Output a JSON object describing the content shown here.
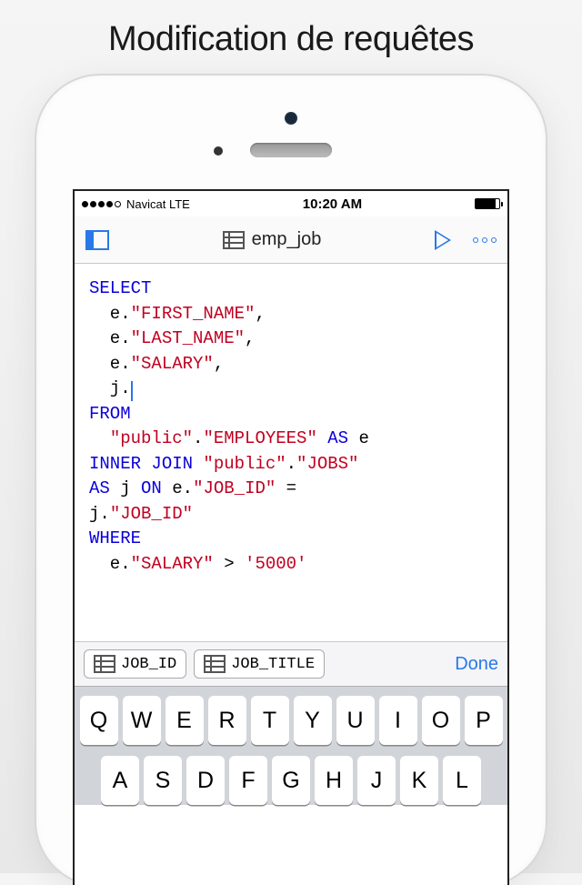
{
  "promo": {
    "title": "Modification de requêtes"
  },
  "status_bar": {
    "carrier": "Navicat LTE",
    "time": "10:20 AM"
  },
  "nav": {
    "title": "emp_job"
  },
  "code": {
    "l1": "SELECT",
    "l2a": "  e.",
    "l2b": "\"FIRST_NAME\"",
    "l2c": ",",
    "l3a": "  e.",
    "l3b": "\"LAST_NAME\"",
    "l3c": ",",
    "l4a": "  e.",
    "l4b": "\"SALARY\"",
    "l4c": ",",
    "l5a": "  j.",
    "l6": "FROM",
    "l7a": "  ",
    "l7b": "\"public\"",
    "l7c": ".",
    "l7d": "\"EMPLOYEES\"",
    "l7e": " AS",
    "l7f": " e",
    "l8a": "INNER JOIN ",
    "l8b": "\"public\"",
    "l8c": ".",
    "l8d": "\"JOBS\"",
    "l9a": "AS",
    "l9b": " j ",
    "l9c": "ON",
    "l9d": " e.",
    "l9e": "\"JOB_ID\"",
    "l9f": " =",
    "l10a": "j.",
    "l10b": "\"JOB_ID\"",
    "l11": "WHERE",
    "l12a": "  e.",
    "l12b": "\"SALARY\"",
    "l12c": " > ",
    "l12d": "'5000'"
  },
  "suggestions": {
    "s1": "JOB_ID",
    "s2": "JOB_TITLE"
  },
  "actions": {
    "done": "Done"
  },
  "keyboard": {
    "row1": [
      "Q",
      "W",
      "E",
      "R",
      "T",
      "Y",
      "U",
      "I",
      "O",
      "P"
    ],
    "row2": [
      "A",
      "S",
      "D",
      "F",
      "G",
      "H",
      "J",
      "K",
      "L"
    ]
  }
}
